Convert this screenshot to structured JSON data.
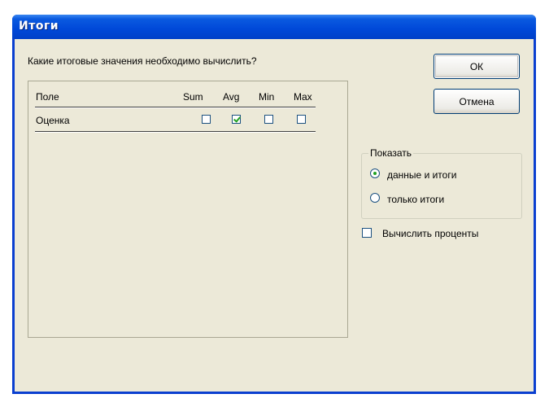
{
  "window": {
    "title": "Итоги"
  },
  "dialog": {
    "prompt": "Какие итоговые значения необходимо вычислить?",
    "table": {
      "columns": {
        "field": "Поле",
        "sum": "Sum",
        "avg": "Avg",
        "min": "Min",
        "max": "Max"
      },
      "rows": [
        {
          "field": "Оценка",
          "sum": false,
          "avg": true,
          "min": false,
          "max": false
        }
      ]
    },
    "buttons": {
      "ok": "ОК",
      "cancel": "Отмена"
    },
    "show_group": {
      "legend": "Показать",
      "options": [
        {
          "label": "данные и итоги",
          "selected": true
        },
        {
          "label": "только итоги",
          "selected": false
        }
      ]
    },
    "percent_checkbox": {
      "label": "Вычислить проценты",
      "checked": false
    }
  }
}
